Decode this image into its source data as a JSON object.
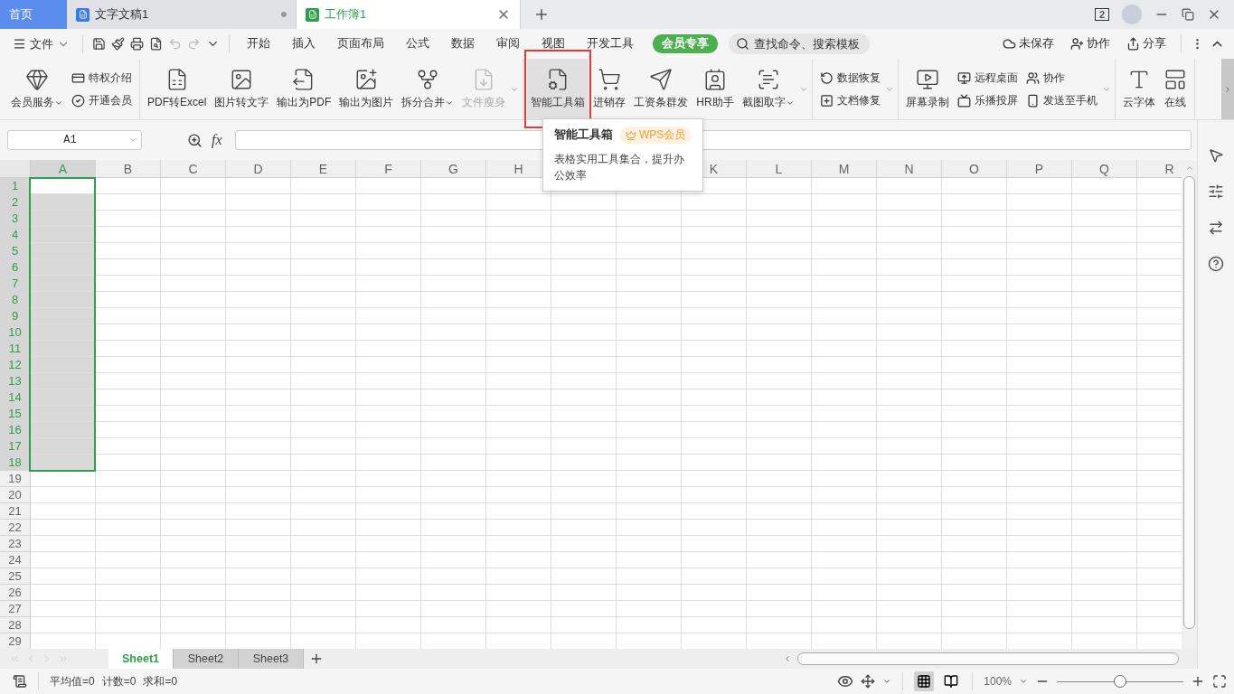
{
  "title_tabs": [
    {
      "label": "首页",
      "kind": "home",
      "selected": false
    },
    {
      "label": "文字文稿1",
      "kind": "doc",
      "selected": false
    },
    {
      "label": "工作簿1",
      "kind": "sheet",
      "selected": true
    }
  ],
  "window_badge": "2",
  "menu": {
    "file": "文件",
    "tabs": [
      {
        "label": "开始",
        "selected": false
      },
      {
        "label": "插入",
        "selected": false
      },
      {
        "label": "页面布局",
        "selected": false
      },
      {
        "label": "公式",
        "selected": false
      },
      {
        "label": "数据",
        "selected": false
      },
      {
        "label": "审阅",
        "selected": false
      },
      {
        "label": "视图",
        "selected": false
      },
      {
        "label": "开发工具",
        "selected": false
      }
    ],
    "member": "会员专享",
    "search": {
      "placeholder": "查找命令、搜索模板"
    },
    "actions": [
      "未保存",
      "协作",
      "分享"
    ]
  },
  "ribbon": [
    {
      "more": false,
      "items": [
        {
          "kind": "big",
          "label": "会员服务",
          "dropdown": true,
          "disabled": false,
          "hovered": false
        },
        {
          "kind": "stack",
          "items": [
            {
              "label": "特权介绍"
            },
            {
              "label": "开通会员"
            }
          ]
        }
      ]
    },
    {
      "more": true,
      "items": [
        {
          "kind": "big",
          "label": "PDF转Excel",
          "dropdown": false,
          "disabled": false,
          "hovered": false
        },
        {
          "kind": "big",
          "label": "图片转文字",
          "dropdown": false,
          "disabled": false,
          "hovered": false
        },
        {
          "kind": "big",
          "label": "输出为PDF",
          "dropdown": false,
          "disabled": false,
          "hovered": false
        },
        {
          "kind": "big",
          "label": "输出为图片",
          "dropdown": false,
          "disabled": false,
          "hovered": false
        },
        {
          "kind": "big",
          "label": "拆分合并",
          "dropdown": true,
          "disabled": false,
          "hovered": false
        },
        {
          "kind": "big",
          "label": "文件瘦身",
          "dropdown": false,
          "disabled": true,
          "hovered": false
        }
      ]
    },
    {
      "more": true,
      "items": [
        {
          "kind": "big",
          "label": "智能工具箱",
          "dropdown": false,
          "disabled": false,
          "hovered": true
        },
        {
          "kind": "big",
          "label": "进销存",
          "dropdown": false,
          "disabled": false,
          "hovered": false
        },
        {
          "kind": "big",
          "label": "工资条群发",
          "dropdown": false,
          "disabled": false,
          "hovered": false
        },
        {
          "kind": "big",
          "label": "HR助手",
          "dropdown": false,
          "disabled": false,
          "hovered": false
        },
        {
          "kind": "big",
          "label": "截图取字",
          "dropdown": true,
          "disabled": false,
          "hovered": false
        }
      ]
    },
    {
      "more": true,
      "items": [
        {
          "kind": "stack",
          "items": [
            {
              "label": "数据恢复"
            },
            {
              "label": "文档修复"
            }
          ]
        }
      ]
    },
    {
      "more": true,
      "items": [
        {
          "kind": "big",
          "label": "屏幕录制",
          "dropdown": false,
          "disabled": false,
          "hovered": false
        },
        {
          "kind": "stack",
          "items": [
            {
              "label": "远程桌面"
            },
            {
              "label": "乐播投屏"
            }
          ]
        },
        {
          "kind": "stack",
          "items": [
            {
              "label": "协作"
            },
            {
              "label": "发送至手机"
            }
          ]
        }
      ]
    },
    {
      "more": false,
      "items": [
        {
          "kind": "big",
          "label": "云字体",
          "dropdown": false,
          "disabled": false,
          "hovered": false
        },
        {
          "kind": "big",
          "label": "在线",
          "dropdown": false,
          "disabled": false,
          "hovered": false
        }
      ]
    }
  ],
  "tooltip": {
    "title": "智能工具箱",
    "badge": "WPS会员",
    "text": "表格实用工具集合，提升办公效率"
  },
  "name_box": "A1",
  "fx": "fx",
  "columns": [
    {
      "label": "A",
      "selected": true
    },
    {
      "label": "B",
      "selected": false
    },
    {
      "label": "C",
      "selected": false
    },
    {
      "label": "D",
      "selected": false
    },
    {
      "label": "E",
      "selected": false
    },
    {
      "label": "F",
      "selected": false
    },
    {
      "label": "G",
      "selected": false
    },
    {
      "label": "H",
      "selected": false
    },
    {},
    {},
    {
      "label": "K",
      "selected": false
    },
    {
      "label": "L",
      "selected": false
    },
    {
      "label": "M",
      "selected": false
    },
    {
      "label": "N",
      "selected": false
    },
    {
      "label": "O",
      "selected": false
    },
    {
      "label": "P",
      "selected": false
    },
    {
      "label": "Q",
      "selected": false
    },
    {
      "label": "R",
      "selected": false
    }
  ],
  "rows": [
    {
      "label": "1",
      "selected": true
    },
    {
      "label": "2",
      "selected": true
    },
    {
      "label": "3",
      "selected": true
    },
    {
      "label": "4",
      "selected": true
    },
    {
      "label": "5",
      "selected": true
    },
    {
      "label": "6",
      "selected": true
    },
    {
      "label": "7",
      "selected": true
    },
    {
      "label": "8",
      "selected": true
    },
    {
      "label": "9",
      "selected": true
    },
    {
      "label": "10",
      "selected": true
    },
    {
      "label": "11",
      "selected": true
    },
    {
      "label": "12",
      "selected": true
    },
    {
      "label": "13",
      "selected": true
    },
    {
      "label": "14",
      "selected": true
    },
    {
      "label": "15",
      "selected": true
    },
    {
      "label": "16",
      "selected": true
    },
    {
      "label": "17",
      "selected": true
    },
    {
      "label": "18",
      "selected": true
    },
    {
      "label": "19",
      "selected": false
    },
    {
      "label": "20",
      "selected": false
    },
    {
      "label": "21",
      "selected": false
    },
    {
      "label": "22",
      "selected": false
    },
    {
      "label": "23",
      "selected": false
    },
    {
      "label": "24",
      "selected": false
    },
    {
      "label": "25",
      "selected": false
    },
    {
      "label": "26",
      "selected": false
    },
    {
      "label": "27",
      "selected": false
    },
    {
      "label": "28",
      "selected": false
    },
    {
      "label": "29",
      "selected": false
    }
  ],
  "sheets": [
    {
      "label": "Sheet1",
      "selected": true
    },
    {
      "label": "Sheet2",
      "selected": false
    },
    {
      "label": "Sheet3",
      "selected": false
    }
  ],
  "status": [
    "平均值=0",
    "计数=0",
    "求和=0"
  ],
  "zoom": {
    "value": "100%",
    "level": 0.5
  }
}
